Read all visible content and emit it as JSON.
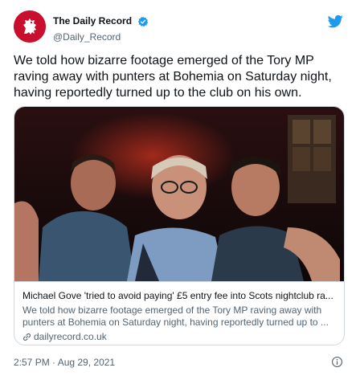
{
  "author": {
    "display_name": "The Daily Record",
    "handle": "@Daily_Record",
    "verified": true,
    "avatar_icon": "lion-rampant-logo",
    "brand_color": "#c8102e"
  },
  "tweet": {
    "text": "We told how bizarre footage emerged of the Tory MP raving away with punters at Bohemia on Saturday night, having reportedly turned up to the club on his own.",
    "timestamp": "2:57 PM · Aug 29, 2021"
  },
  "card": {
    "title": "Michael Gove 'tried to avoid paying' £5 entry fee into Scots nightclub ra...",
    "description_line1": "We told how bizarre footage emerged of the Tory MP raving away with",
    "description_line2": "punters at Bohemia on Saturday night, having reportedly turned up to ...",
    "domain": "dailyrecord.co.uk",
    "domain_icon": "link-icon"
  },
  "icons": {
    "platform": "twitter-bird-icon",
    "verified": "verified-badge-icon",
    "info": "info-icon"
  },
  "colors": {
    "twitter_blue": "#1d9bf0",
    "secondary_text": "#536471",
    "border": "#cfd9de"
  }
}
